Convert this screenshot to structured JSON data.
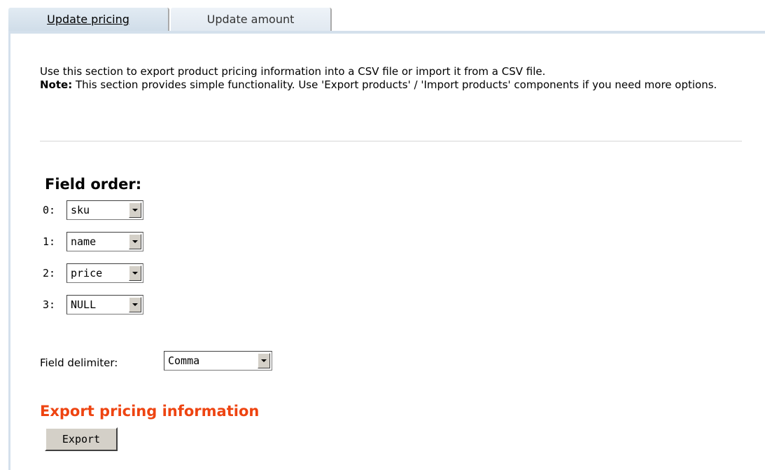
{
  "tabs": [
    {
      "label": "Update pricing",
      "active": true
    },
    {
      "label": "Update amount",
      "active": false
    }
  ],
  "intro": {
    "line1": "Use this section to export product pricing information into a CSV file or import it from a CSV file.",
    "note_label": "Note:",
    "note_text": " This section provides simple functionality. Use 'Export products' / 'Import products' components if you need more options."
  },
  "field_order": {
    "title": "Field order:",
    "rows": [
      {
        "index": "0:",
        "value": "sku"
      },
      {
        "index": "1:",
        "value": "name"
      },
      {
        "index": "2:",
        "value": "price"
      },
      {
        "index": "3:",
        "value": "NULL"
      }
    ]
  },
  "delimiter": {
    "label": "Field delimiter:",
    "value": "Comma"
  },
  "export": {
    "title": "Export pricing information",
    "button_label": "Export"
  },
  "colors": {
    "accent": "#ee4411",
    "tab_bg": "#d4e0ec"
  }
}
